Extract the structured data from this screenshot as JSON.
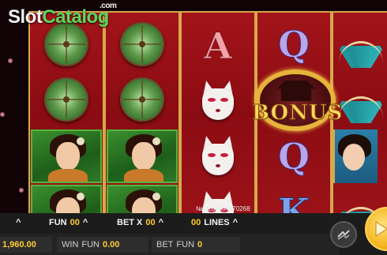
{
  "logo": {
    "part1": "Slot",
    "part2": "Catalog",
    "suffix": ".com"
  },
  "reels": {
    "col1": [
      "parasol",
      "parasol",
      "geisha",
      "geisha"
    ],
    "col2": [
      "parasol",
      "parasol",
      "geisha",
      "geisha"
    ],
    "col3": [
      "A",
      "fox-mask",
      "fox-mask",
      "fox-mask"
    ],
    "col4": [
      "Q",
      "BONUS",
      "Q",
      "K"
    ],
    "col5": [
      "fan",
      "fan",
      "girl",
      "fan"
    ]
  },
  "symbols": {
    "a": "A",
    "q": "Q",
    "k": "K",
    "bonus": "BONUS"
  },
  "game_id": "№ 7284364870268",
  "controls": {
    "caret_up": "^",
    "fun_label": "FUN",
    "fun_value": "00",
    "bet_x_label": "BET X",
    "bet_x_value": "00",
    "lines_value": "00",
    "lines_label": "LINES",
    "credit": "1,960.00",
    "win_label": "WIN",
    "win_fun_label": "FUN",
    "win_value": "0.00",
    "bet_label": "BET",
    "bet_fun_label": "FUN",
    "bet_value": "0"
  },
  "colors": {
    "accent": "#ffcc33",
    "reel_bg": "#8b0d12",
    "frame": "#d7a94b"
  }
}
